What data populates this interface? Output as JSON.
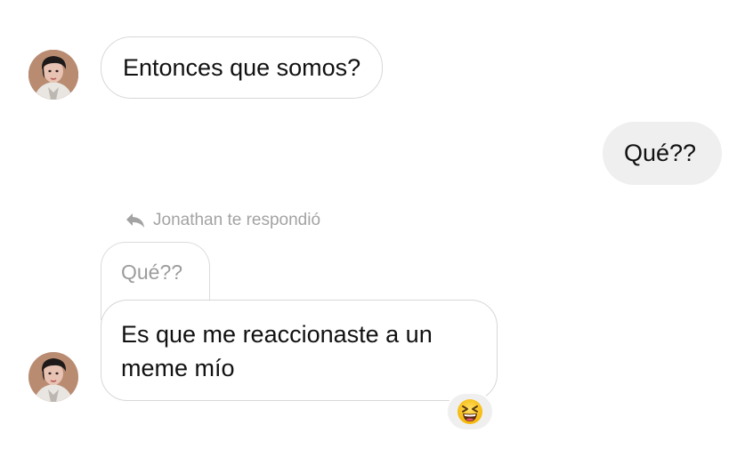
{
  "messages": [
    {
      "sender": "Jonathan",
      "direction": "incoming",
      "text": "Entonces que somos?"
    },
    {
      "sender": "me",
      "direction": "outgoing",
      "text": "Qué??"
    },
    {
      "sender": "Jonathan",
      "direction": "incoming",
      "reply_label": "Jonathan te respondió",
      "quoted_text": "Qué??",
      "text": "Es que me reaccionaste a un meme mío",
      "reaction": "😆"
    }
  ],
  "colors": {
    "incoming_bubble_border": "#d7d7d7",
    "outgoing_bubble_bg": "#efefef",
    "secondary_text": "#a3a3a3",
    "reaction_bg": "#efefef"
  },
  "icons": {
    "avatar": "profile-photo",
    "reply": "reply-arrow-icon",
    "reaction": "grinning-squinting-face-emoji"
  }
}
